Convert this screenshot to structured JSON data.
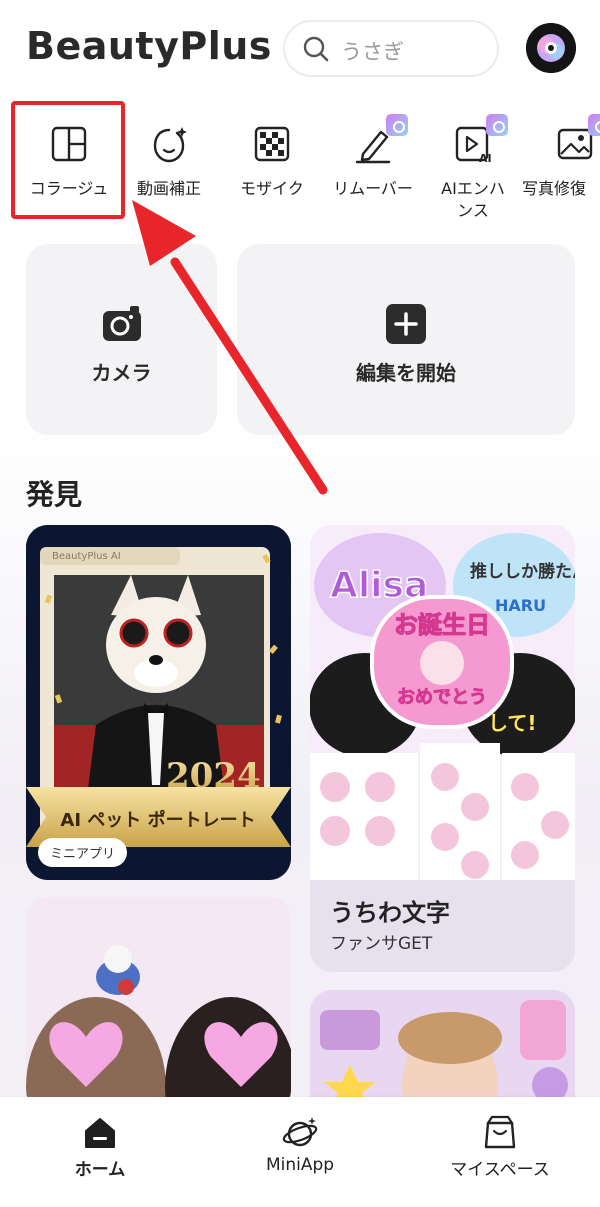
{
  "header": {
    "app_title": "BeautyPlus",
    "search_placeholder": "うさぎ",
    "avatar_icon": "profile-avatar"
  },
  "tools": [
    {
      "label": "コラージュ",
      "icon": "collage-icon",
      "premium": false
    },
    {
      "label": "動画補正",
      "icon": "face-retouch-icon",
      "premium": false
    },
    {
      "label": "モザイク",
      "icon": "mosaic-icon",
      "premium": false
    },
    {
      "label": "リムーバー",
      "icon": "eraser-icon",
      "premium": true
    },
    {
      "label": "AIエンハンス",
      "icon": "ai-enhance-icon",
      "premium": true
    },
    {
      "label": "写真修復",
      "icon": "photo-restore-icon",
      "premium": true
    }
  ],
  "actions": {
    "camera_label": "カメラ",
    "edit_label": "編集を開始"
  },
  "discover": {
    "title": "発見",
    "pet_card": {
      "brand": "BeautyPlus AI",
      "year": "2024",
      "banner": "AI ペット ポートレート",
      "tag": "ミニアプリ"
    },
    "uchiwa_card": {
      "title": "うちわ文字",
      "subtitle": "ファンサGET",
      "sticker_texts": [
        "Alisa",
        "推ししか勝たん",
        "お誕生日",
        "おめでとう",
        "して!",
        "HARU"
      ]
    }
  },
  "bottom_nav": {
    "home_label": "ホーム",
    "miniapp_label": "MiniApp",
    "myspace_label": "マイスペース"
  },
  "colors": {
    "highlight": "#e8252a",
    "text": "#222222",
    "card_bg": "#f3f3f5"
  }
}
